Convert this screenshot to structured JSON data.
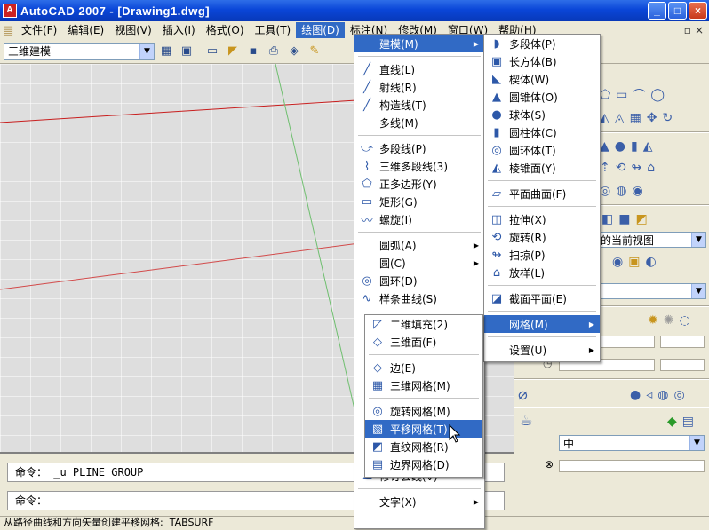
{
  "window": {
    "title": "AutoCAD 2007 - [Drawing1.dwg]",
    "buttons": [
      "_",
      "□",
      "×"
    ]
  },
  "menubar": {
    "items": [
      "文件(F)",
      "编辑(E)",
      "视图(V)",
      "插入(I)",
      "格式(O)",
      "工具(T)",
      "绘图(D)",
      "标注(N)",
      "修改(M)",
      "窗口(W)",
      "帮助(H)"
    ],
    "mdi_buttons": [
      "_",
      "▫",
      "×"
    ]
  },
  "toolbar": {
    "workspace": "三维建模"
  },
  "commands": {
    "history": "命令： _u PLINE GROUP",
    "prompt": "命令："
  },
  "status": {
    "text": "从路径曲线和方向矢量创建平移网格:  TABSURF"
  },
  "panel": {
    "view_combo": "的当前视图",
    "select_combo": "",
    "quality": "中"
  },
  "draw_menu": [
    {
      "label": "建模(M)",
      "icon": "",
      "sub": true,
      "hl": true
    },
    {
      "sep": true
    },
    {
      "label": "直线(L)",
      "icon": "line-icon"
    },
    {
      "label": "射线(R)",
      "icon": "ray-icon"
    },
    {
      "label": "构造线(T)",
      "icon": "xline-icon"
    },
    {
      "label": "多线(M)",
      "icon": ""
    },
    {
      "sep": true
    },
    {
      "label": "多段线(P)",
      "icon": "polyline-icon"
    },
    {
      "label": "三维多段线(3)",
      "icon": "3dpoly-icon"
    },
    {
      "label": "正多边形(Y)",
      "icon": "polygon-icon"
    },
    {
      "label": "矩形(G)",
      "icon": "rectangle-icon"
    },
    {
      "label": "螺旋(I)",
      "icon": "helix-icon"
    },
    {
      "sep": true
    },
    {
      "label": "圆弧(A)",
      "icon": "",
      "sub": true
    },
    {
      "label": "圆(C)",
      "icon": "",
      "sub": true
    },
    {
      "label": "圆环(D)",
      "icon": "donut-icon"
    },
    {
      "label": "样条曲线(S)",
      "icon": "spline-icon"
    },
    {
      "label": "",
      "icon": ""
    },
    {
      "label": "",
      "icon": ""
    },
    {
      "label": "",
      "icon": ""
    },
    {
      "label": "",
      "icon": ""
    },
    {
      "label": "",
      "icon": ""
    },
    {
      "label": "",
      "icon": ""
    },
    {
      "label": "",
      "icon": ""
    },
    {
      "label": "",
      "icon": ""
    },
    {
      "label": "",
      "icon": ""
    },
    {
      "label": "修订云线(V)",
      "icon": "revcloud-icon"
    },
    {
      "sep": true
    },
    {
      "label": "文字(X)",
      "icon": "",
      "sub": true
    }
  ],
  "modeling_menu": [
    {
      "label": "多段体(P)",
      "icon": "polysolid-icon"
    },
    {
      "label": "长方体(B)",
      "icon": "box-icon"
    },
    {
      "label": "楔体(W)",
      "icon": "wedge-icon"
    },
    {
      "label": "圆锥体(O)",
      "icon": "cone-icon"
    },
    {
      "label": "球体(S)",
      "icon": "sphere-icon"
    },
    {
      "label": "圆柱体(C)",
      "icon": "cylinder-icon"
    },
    {
      "label": "圆环体(T)",
      "icon": "torus-icon"
    },
    {
      "label": "棱锥面(Y)",
      "icon": "pyramid-icon"
    },
    {
      "sep": true
    },
    {
      "label": "平面曲面(F)",
      "icon": "planesurf-icon"
    },
    {
      "sep": true
    },
    {
      "label": "拉伸(X)",
      "icon": "extrude-icon"
    },
    {
      "label": "旋转(R)",
      "icon": "revolve-icon"
    },
    {
      "label": "扫掠(P)",
      "icon": "sweep-icon"
    },
    {
      "label": "放样(L)",
      "icon": "loft-icon"
    },
    {
      "sep": true
    },
    {
      "label": "截面平面(E)",
      "icon": "section-icon"
    },
    {
      "sep": true
    },
    {
      "label": "网格(M)",
      "icon": "",
      "sub": true,
      "hl": true
    },
    {
      "sep": true
    },
    {
      "label": "设置(U)",
      "icon": "",
      "sub": true
    }
  ],
  "mesh_menu": [
    {
      "label": "二维填充(2)",
      "icon": "solid-fill-icon"
    },
    {
      "label": "三维面(F)",
      "icon": "3dface-icon"
    },
    {
      "sep": true
    },
    {
      "label": "边(E)",
      "icon": "edge-icon"
    },
    {
      "label": "三维网格(M)",
      "icon": "3dmesh-icon"
    },
    {
      "sep": true
    },
    {
      "label": "旋转网格(M)",
      "icon": "revsurf-icon"
    },
    {
      "label": "平移网格(T)",
      "icon": "tabsurf-icon",
      "hl": true
    },
    {
      "label": "直纹网格(R)",
      "icon": "rulesurf-icon"
    },
    {
      "label": "边界网格(D)",
      "icon": "edgesurf-icon"
    }
  ],
  "colors": {
    "titlebar": "#0a46d8",
    "highlight": "#316ac5",
    "menu_bg": "#ece9d8",
    "viewport": "#dedede",
    "axis_red": "#c81e1e",
    "axis_green": "#2a9a2a"
  }
}
